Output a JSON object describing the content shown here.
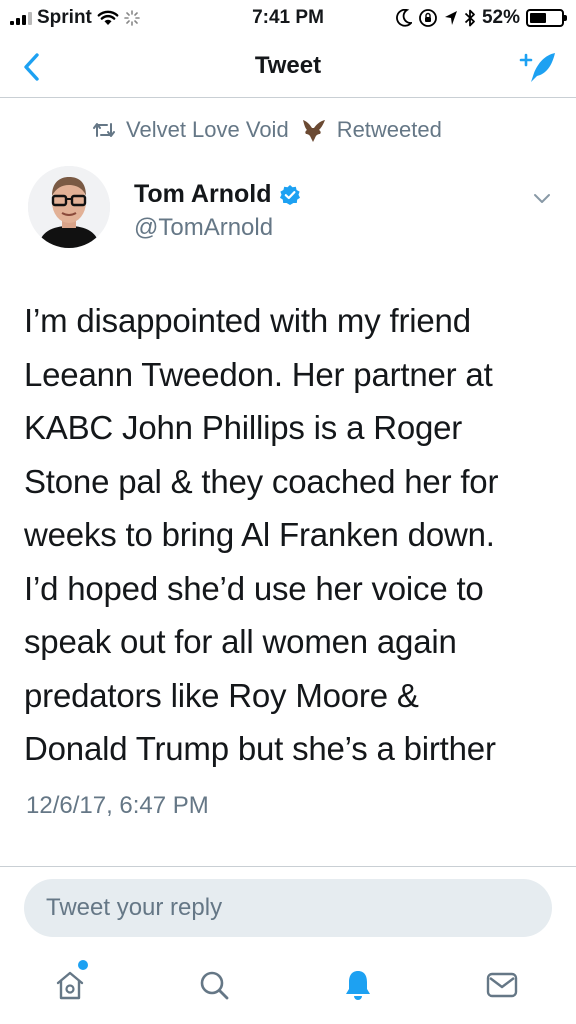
{
  "status_bar": {
    "carrier": "Sprint",
    "time": "7:41 PM",
    "battery": "52%",
    "battery_level": 0.52
  },
  "nav": {
    "title": "Tweet",
    "back_icon": "chevron-left-icon",
    "compose_icon": "compose-tweet-icon"
  },
  "retweet_context": {
    "user": "Velvet Love Void",
    "label": "Retweeted"
  },
  "tweet": {
    "author_name": "Tom Arnold",
    "author_handle": "@TomArnold",
    "verified": true,
    "text_lines": [
      "I’m disappointed with my friend",
      "Leeann Tweedon. Her partner at",
      "KABC John Phillips is a Roger",
      "Stone pal & they coached her for",
      "weeks to bring Al Franken down.",
      "I’d hoped she’d use her voice to",
      "speak out for all women again",
      "predators like Roy Moore &",
      "Donald Trump but she’s a birther"
    ],
    "timestamp": "12/6/17, 6:47 PM"
  },
  "reply": {
    "placeholder": "Tweet your reply"
  },
  "tab_bar": {
    "items": [
      "home-icon",
      "search-icon",
      "notifications-icon",
      "messages-icon"
    ],
    "active": "notifications-icon"
  },
  "colors": {
    "accent": "#1da1f2",
    "secondary_text": "#657786",
    "primary_text": "#14171a",
    "reply_bg": "#e6ecf0"
  }
}
